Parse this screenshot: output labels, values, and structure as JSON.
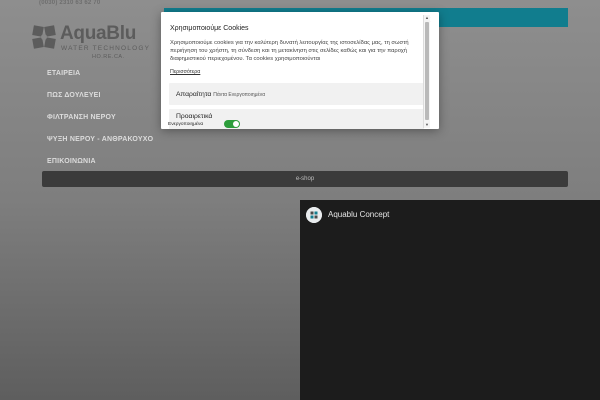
{
  "header": {
    "phone": "(0030) 2310 63 62 70",
    "accent_color": "#117d8e"
  },
  "logo": {
    "wordmark": "AquaBlu",
    "tagline": "WATER TECHNOLOGY",
    "sub": "HO.RE.CA.",
    "icon": "logo-mark-icon"
  },
  "nav": {
    "items": [
      {
        "label": "ΕΤΑΙΡΕΙΑ"
      },
      {
        "label": "ΠΩΣ ΔΟΥΛΕΥΕΙ"
      },
      {
        "label": "ΦΙΛΤΡΑΝΣΗ ΝΕΡΟΥ"
      },
      {
        "label": "ΨΥΞΗ ΝΕΡΟΥ - ΑΝΘΡΑΚΟΥΧΟ"
      },
      {
        "label": "ΕΠΙΚΟΙΝΩΝΙΑ"
      }
    ]
  },
  "eshop": {
    "label": "e-shop"
  },
  "video": {
    "channel_title": "Aquablu Concept"
  },
  "cookie_modal": {
    "title": "Χρησιμοποιούμε Cookies",
    "close_label": "×",
    "body": "Χρησιμοποιούμε cookies για την καλύτερη δυνατή λειτουργίας της ιστοσελίδας μας, τη σωστή περιήγηση του χρήστη, τη σύνδεση και τη μετακίνηση στις σελίδες καθώς και για την παροχή διαφημιστικού περιεχομένου. Τα cookies χρησιμοποιούνται",
    "more_link": "Περισσότερα",
    "categories": [
      {
        "label": "Απαραίτητα",
        "status": "Πάντα Ενεργοποιημένα"
      },
      {
        "label": "Προαιρετικά",
        "status": "Ενεργοποιημένα",
        "enabled": true
      }
    ],
    "toggle_color": "#2c9d3b"
  }
}
